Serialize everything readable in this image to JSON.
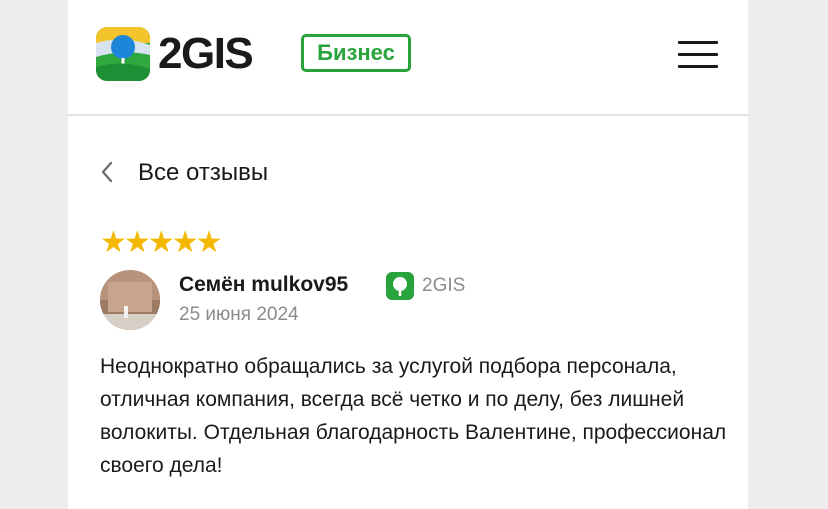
{
  "header": {
    "logo_text": "2GIS",
    "business_badge": "Бизнес",
    "menu_icon": "hamburger-menu-icon"
  },
  "navigation": {
    "back_icon": "chevron-left-icon",
    "back_label": "Все отзывы"
  },
  "review": {
    "rating": 5,
    "max_rating": 5,
    "author": "Семён mulkov95",
    "source_icon": "2gis-pin-icon",
    "source": "2GIS",
    "date": "25 июня 2024",
    "text": "Неоднократно обращались за услугой подбора персонала, отличная компания, всегда всё четко и по делу, без лишней волокиты. Отдельная благодарность Валентине, профессионал своего дела!"
  },
  "colors": {
    "brand_green": "#29a33b",
    "star_gold": "#f5b800",
    "star_empty": "#d8d8d8",
    "muted_text": "#8c8c8c",
    "page_background": "#ececec"
  }
}
